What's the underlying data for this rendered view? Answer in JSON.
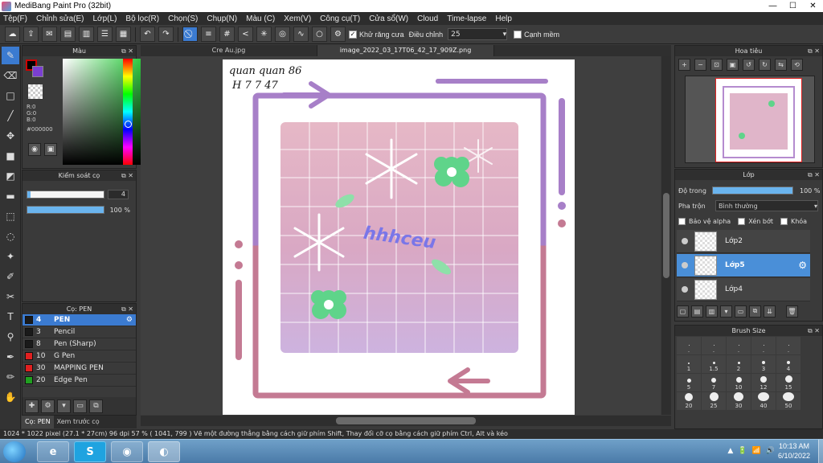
{
  "window": {
    "title": "MediBang Paint Pro (32bit)",
    "controls": [
      "—",
      "☐",
      "✕"
    ]
  },
  "menu": [
    "Tệp(F)",
    "Chỉnh sửa(E)",
    "Lớp(L)",
    "Bộ lọc(R)",
    "Chọn(S)",
    "Chụp(N)",
    "Màu (C)",
    "Xem(V)",
    "Công cụ(T)",
    "Cửa sổ(W)",
    "Cloud",
    "Time-lapse",
    "Help"
  ],
  "toolbar": {
    "antialias_label": "Khử răng cưa",
    "antialias_checked": true,
    "adjust_label": "Điều chỉnh",
    "adjust_value": "25",
    "sharp_label": "Cạnh mềm",
    "sharp_checked": false
  },
  "color_panel": {
    "title": "Màu",
    "r": "R:0",
    "g": "G:0",
    "b": "B:0",
    "hex": "#000000"
  },
  "brush_control": {
    "title": "Kiểm soát cọ",
    "size": "4",
    "opacity": "100 %",
    "opacity_fraction": 1.0,
    "size_fraction": 0.04
  },
  "brush_list": {
    "title": "Cọ: PEN",
    "items": [
      {
        "size": "4",
        "name": "PEN",
        "color": "#1a1a1a",
        "active": true
      },
      {
        "size": "3",
        "name": "Pencil",
        "color": "#1a1a1a",
        "active": false
      },
      {
        "size": "8",
        "name": "Pen (Sharp)",
        "color": "#1a1a1a",
        "active": false
      },
      {
        "size": "10",
        "name": "G Pen",
        "color": "#e02020",
        "active": false
      },
      {
        "size": "30",
        "name": "MAPPING PEN",
        "color": "#e02020",
        "active": false
      },
      {
        "size": "20",
        "name": "Edge Pen",
        "color": "#20a020",
        "active": false
      }
    ]
  },
  "left_tabs": [
    "Cọ: PEN",
    "Xem trước cọ"
  ],
  "documents": {
    "tabs": [
      "Cre Au.jpg",
      "image_2022_03_17T06_42_17_909Z.png"
    ],
    "active_index": 1
  },
  "canvas": {
    "handwriting_line1": "quan quan 86",
    "handwriting_line2": "H 7 7 47",
    "stamp_text": "hhhceu"
  },
  "navigator": {
    "title": "Hoa tiêu"
  },
  "layer_panel": {
    "title": "Lớp",
    "opacity_label": "Độ trong",
    "opacity_value": "100 %",
    "blend_label": "Pha trộn",
    "blend_value": "Bình thường",
    "protect_alpha": "Bảo vệ alpha",
    "clip": "Xén bớt",
    "lock": "Khóa",
    "layers": [
      {
        "name": "Lớp2",
        "active": false
      },
      {
        "name": "Lớp5",
        "active": true
      },
      {
        "name": "Lớp4",
        "active": false
      }
    ]
  },
  "brush_size_panel": {
    "title": "Brush Size",
    "sizes": [
      ".",
      ".",
      ".",
      ".",
      ".",
      "1",
      "1.5",
      "2",
      "3",
      "4",
      "5",
      "7",
      "10",
      "12",
      "15",
      "20",
      "25",
      "30",
      "40",
      "50"
    ]
  },
  "status": {
    "text": "1024 * 1022 pixel   (27.1 * 27cm)   96 dpi   57 %   ( 1041, 799 )   Vẽ một đường thẳng bằng cách giữ phím Shift, Thay đổi cỡ cọ bằng cách giữ phím Ctrl, Alt và kéo"
  },
  "taskbar": {
    "time": "10:13 AM",
    "date": "6/10/2022",
    "tray": [
      "▲",
      "🔋",
      "📶",
      "🔊"
    ]
  },
  "colors": {
    "accent": "#3b7bd1",
    "frame_purple": "#a77fc8",
    "frame_rose": "#c47a93"
  }
}
